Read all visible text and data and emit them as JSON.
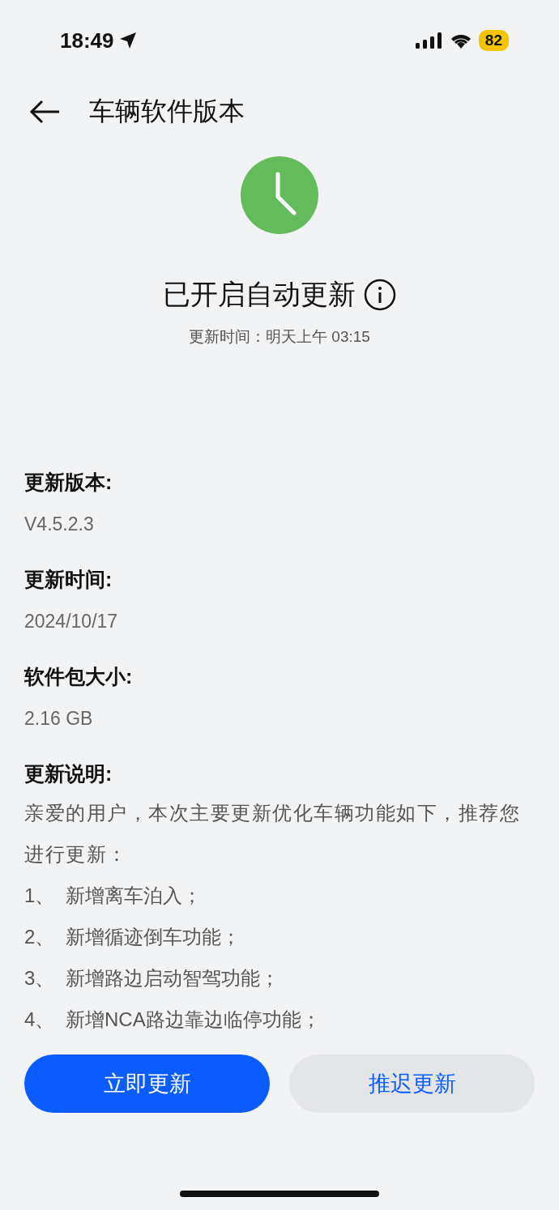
{
  "status_bar": {
    "time": "18:49",
    "battery": "82"
  },
  "header": {
    "title": "车辆软件版本"
  },
  "status": {
    "title": "已开启自动更新",
    "subtitle": "更新时间：明天上午 03:15"
  },
  "details": [
    {
      "label": "更新版本:",
      "value": "V4.5.2.3"
    },
    {
      "label": "更新时间:",
      "value": "2024/10/17"
    },
    {
      "label": "软件包大小:",
      "value": "2.16 GB"
    }
  ],
  "notes": {
    "label": "更新说明:",
    "intro": "亲爱的用户，本次主要更新优化车辆功能如下，推荐您进行更新：",
    "items": [
      {
        "number": "1、",
        "text": "新增离车泊入；"
      },
      {
        "number": "2、",
        "text": "新增循迹倒车功能；"
      },
      {
        "number": "3、",
        "text": "新增路边启动智驾功能；"
      },
      {
        "number": "4、",
        "text": "新增NCA路边靠边临停功能；"
      }
    ]
  },
  "buttons": [
    {
      "label": "立即更新",
      "kind": "primary"
    },
    {
      "label": "推迟更新",
      "kind": "secondary"
    }
  ]
}
